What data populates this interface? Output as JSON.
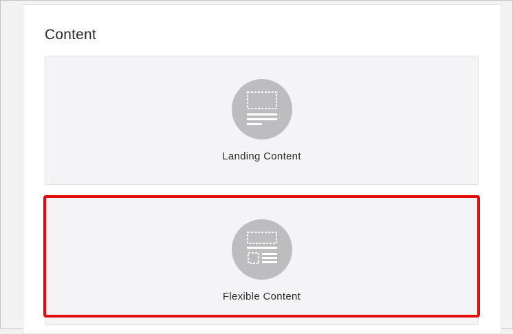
{
  "section": {
    "title": "Content"
  },
  "cards": [
    {
      "label": "Landing Content",
      "icon": "landing-content-icon"
    },
    {
      "label": "Flexible Content",
      "icon": "flexible-content-icon"
    }
  ],
  "colors": {
    "highlight": "#e30b0b",
    "card_background": "#f4f4f6",
    "icon_circle": "#bdbdc0"
  }
}
